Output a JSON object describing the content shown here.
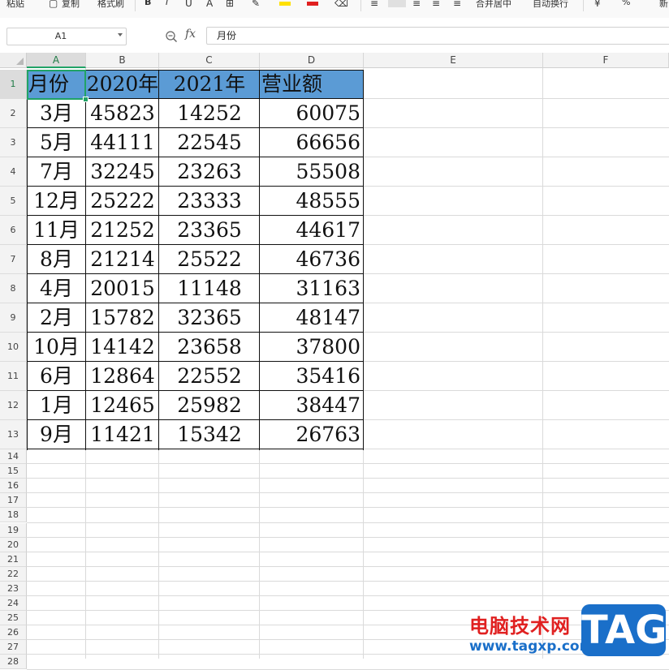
{
  "toolbar": {
    "paste_label": "粘贴",
    "copy_label": "复制",
    "format_painter_label": "格式刷",
    "bold_label": "B",
    "italic_label": "I",
    "merge_center_label": "合并居中",
    "wrap_text_label": "自动换行",
    "percent_label": "%",
    "new_label": "新"
  },
  "formula_bar": {
    "name_box": "A1",
    "fx_label": "fx",
    "formula_value": "月份"
  },
  "grid": {
    "columns": [
      "A",
      "B",
      "C",
      "D",
      "E",
      "F"
    ],
    "rows": [
      "1",
      "2",
      "3",
      "4",
      "5",
      "6",
      "7",
      "8",
      "9",
      "10",
      "11",
      "12",
      "13",
      "14",
      "15",
      "16",
      "17",
      "18",
      "19",
      "20",
      "21",
      "22",
      "23",
      "24",
      "25",
      "26",
      "27",
      "28"
    ],
    "header_fill": "#5b9bd5",
    "selection_color": "#21a366"
  },
  "table": {
    "headers": [
      "月份",
      "2020年",
      "2021年",
      "营业额"
    ],
    "rows": [
      [
        "3月",
        "45823",
        "14252",
        "60075"
      ],
      [
        "5月",
        "44111",
        "22545",
        "66656"
      ],
      [
        "7月",
        "32245",
        "23263",
        "55508"
      ],
      [
        "12月",
        "25222",
        "23333",
        "48555"
      ],
      [
        "11月",
        "21252",
        "23365",
        "44617"
      ],
      [
        "8月",
        "21214",
        "25522",
        "46736"
      ],
      [
        "4月",
        "20015",
        "11148",
        "31163"
      ],
      [
        "2月",
        "15782",
        "32365",
        "48147"
      ],
      [
        "10月",
        "14142",
        "23658",
        "37800"
      ],
      [
        "6月",
        "12864",
        "22552",
        "35416"
      ],
      [
        "1月",
        "12465",
        "25982",
        "38447"
      ],
      [
        "9月",
        "11421",
        "15342",
        "26763"
      ]
    ]
  },
  "watermark": {
    "text": "电脑技术网",
    "url": "www.tagxp.com",
    "logo": "TAG"
  }
}
